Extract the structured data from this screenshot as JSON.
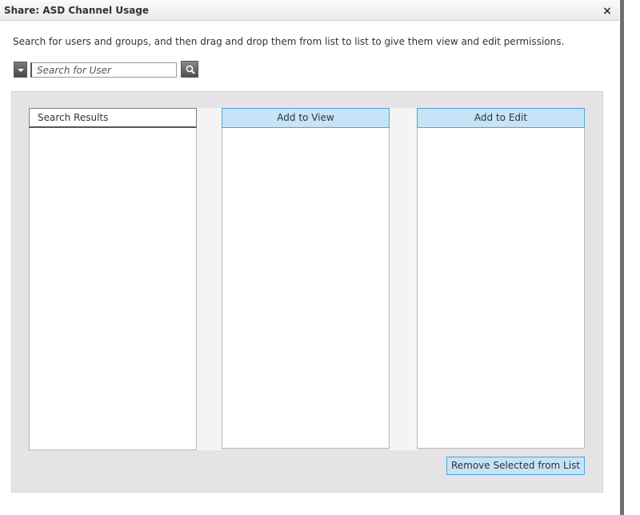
{
  "dialog": {
    "title": "Share: ASD Channel Usage",
    "close_glyph": "×",
    "instructions": "Search for users and groups, and then drag and drop them from list to list to give them view and edit permissions."
  },
  "search": {
    "placeholder": "Search for User",
    "value": "",
    "dropdown_icon": "chevron-down-icon",
    "search_icon": "search-icon"
  },
  "lists": {
    "results_label": "Search Results",
    "view_label": "Add to View",
    "edit_label": "Add to Edit",
    "results_items": [],
    "view_items": [],
    "edit_items": []
  },
  "actions": {
    "remove_label": "Remove Selected from List"
  },
  "colors": {
    "accent_fill": "#c6e3f7",
    "accent_border": "#4da6d6",
    "panel_bg": "#e6e3e6"
  }
}
